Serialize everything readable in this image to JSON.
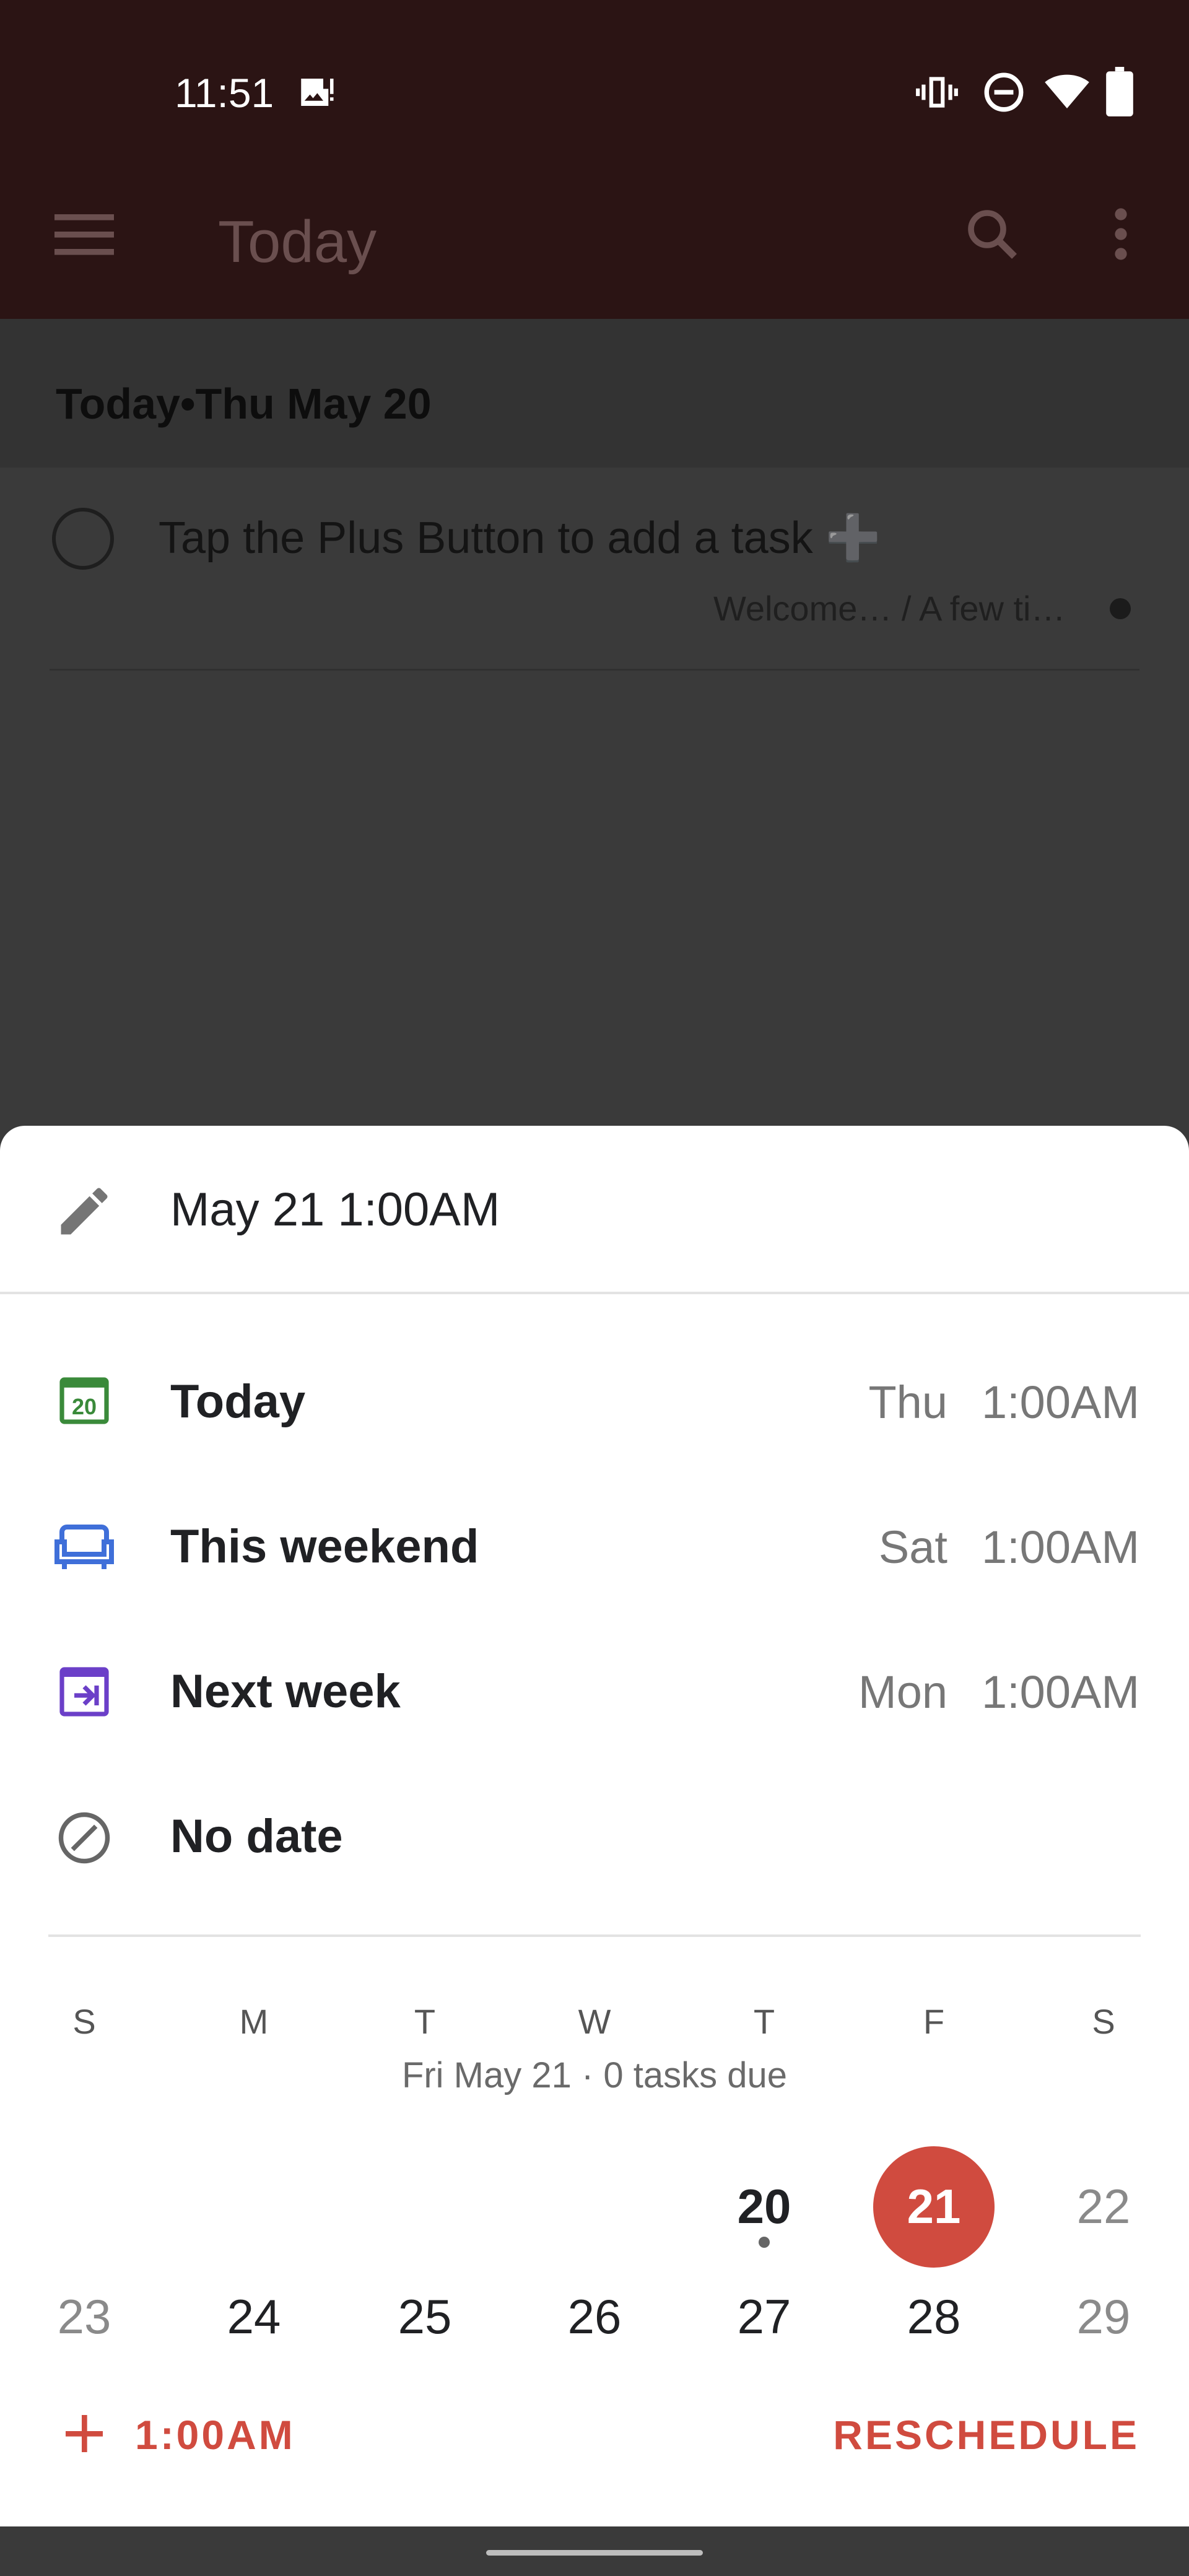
{
  "status_bar": {
    "time": "11:51",
    "icons": [
      "image-alert-icon",
      "vibrate-icon",
      "do-not-disturb-icon",
      "wifi-icon",
      "battery-icon"
    ]
  },
  "app_bar": {
    "title": "Today",
    "icons": [
      "menu-icon",
      "search-icon",
      "more-vert-icon"
    ]
  },
  "section": {
    "title": "Today•Thu May 20"
  },
  "task": {
    "title": "Tap the Plus Button to add a task ➕",
    "meta": "Welcome… / A few ti…"
  },
  "sheet": {
    "edit_value": "May 21 1:00AM",
    "options": [
      {
        "label": "Today",
        "day": "Thu",
        "time": "1:00AM",
        "icon": "calendar-today-icon",
        "color": "#3a8a3a"
      },
      {
        "label": "This weekend",
        "day": "Sat",
        "time": "1:00AM",
        "icon": "sofa-icon",
        "color": "#3f6fd9"
      },
      {
        "label": "Next week",
        "day": "Mon",
        "time": "1:00AM",
        "icon": "next-week-icon",
        "color": "#6b3fc8"
      },
      {
        "label": "No date",
        "day": "",
        "time": "",
        "icon": "no-date-icon",
        "color": "#666666"
      }
    ]
  },
  "calendar": {
    "weekdays": [
      "S",
      "M",
      "T",
      "W",
      "T",
      "F",
      "S"
    ],
    "selected_info": "Fri May 21 · 0 tasks due",
    "row1": [
      "20",
      "21",
      "22"
    ],
    "row2": [
      "23",
      "24",
      "25",
      "26",
      "27",
      "28",
      "29"
    ],
    "accent": "#d04b3f"
  },
  "footer": {
    "time_label": "1:00AM",
    "reschedule_label": "RESCHEDULE"
  }
}
